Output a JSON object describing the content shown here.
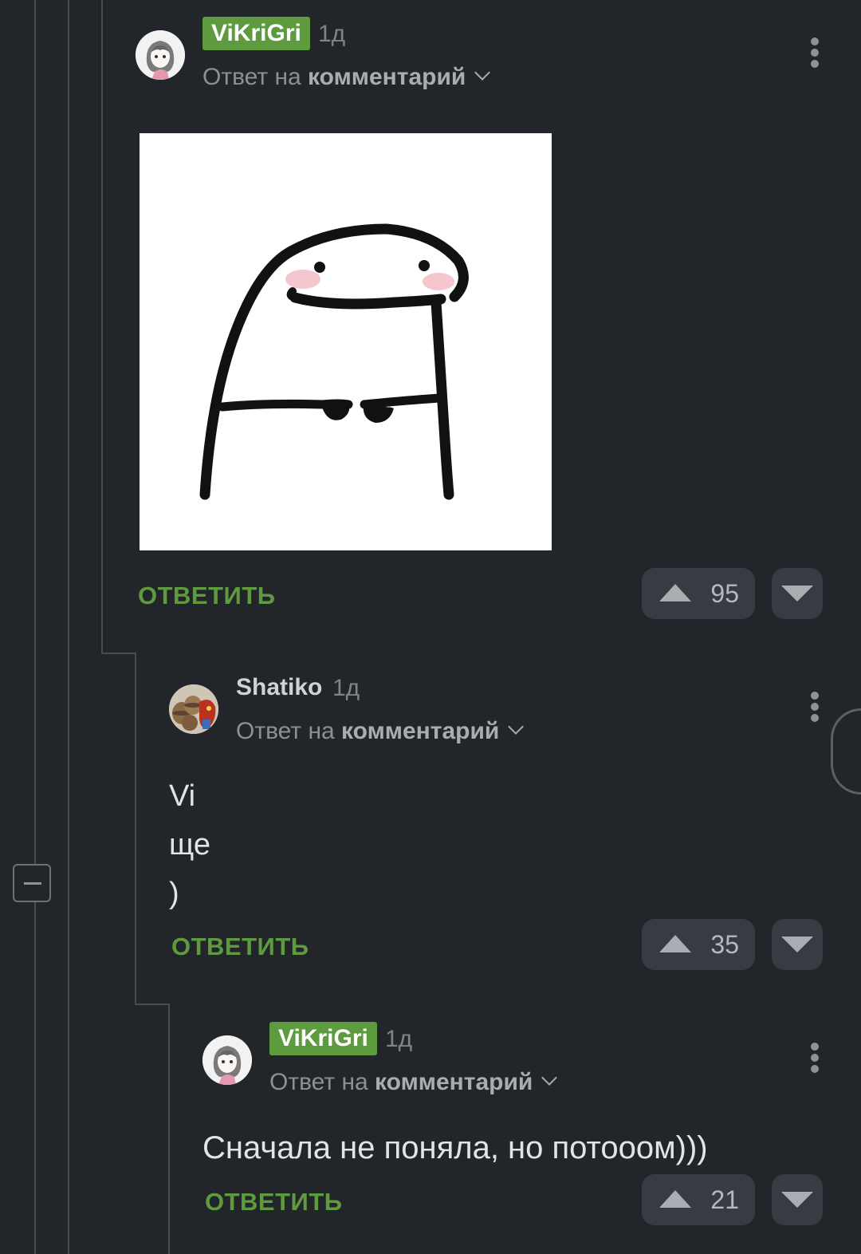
{
  "comments": [
    {
      "username": "ViKriGri",
      "time": "1д",
      "reply_prefix": "Ответ на",
      "reply_target": "комментарий",
      "reply_label": "ОТВЕТИТЬ",
      "score": "95",
      "has_image": true,
      "avatar": "anime-girl-avatar"
    },
    {
      "username": "Shatiko",
      "time": "1д",
      "reply_prefix": "Ответ на",
      "reply_target": "комментарий",
      "text_lines": [
        "Vi",
        "ще",
        ")"
      ],
      "reply_label": "ОТВЕТИТЬ",
      "score": "35",
      "avatar": "barrels-avatar"
    },
    {
      "username": "ViKriGri",
      "time": "1д",
      "reply_prefix": "Ответ на",
      "reply_target": "комментарий",
      "text": "Сначала не поняла, но потооом)))",
      "reply_label": "ОТВЕТИТЬ",
      "score": "21",
      "avatar": "anime-girl-avatar"
    }
  ],
  "colors": {
    "background": "#22262b",
    "accent_green": "#5e9b3e",
    "vote_button_bg": "#383c42",
    "thread_line": "#474c52"
  },
  "icons": [
    "more-vertical-icon",
    "chevron-down-icon",
    "upvote-arrow-icon",
    "downvote-arrow-icon",
    "collapse-minus-icon"
  ]
}
